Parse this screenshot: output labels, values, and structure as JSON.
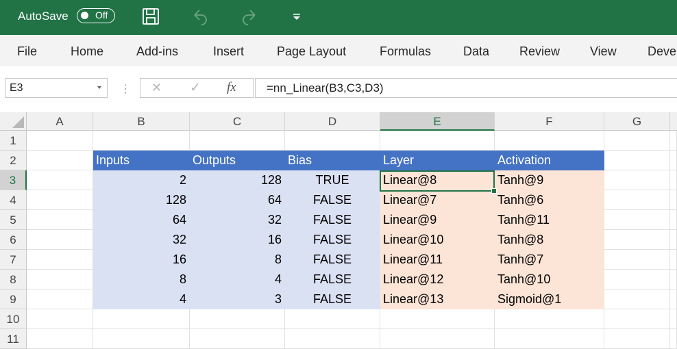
{
  "titlebar": {
    "autosave_label": "AutoSave",
    "autosave_state": "Off",
    "icons": [
      "save-icon",
      "undo-icon",
      "redo-icon",
      "customize-toolbar-icon"
    ],
    "color": "#217346"
  },
  "menu": {
    "file": "File",
    "home": "Home",
    "addins": "Add-ins",
    "insert": "Insert",
    "page_layout": "Page Layout",
    "formulas": "Formulas",
    "data": "Data",
    "review": "Review",
    "view": "View",
    "developer": "Deve"
  },
  "formula_bar": {
    "name_box": "E3",
    "separator": "⋮",
    "cancel_symbol": "✕",
    "enter_symbol": "✓",
    "fx_symbol": "fx",
    "formula": "=nn_Linear(B3,C3,D3)"
  },
  "columns": [
    "A",
    "B",
    "C",
    "D",
    "E",
    "F",
    "G"
  ],
  "rows": [
    "1",
    "2",
    "3",
    "4",
    "5",
    "6",
    "7",
    "8",
    "9",
    "10",
    "11"
  ],
  "table": {
    "headers": [
      "Inputs",
      "Outputs",
      "Bias",
      "Layer",
      "Activation"
    ],
    "rows": [
      [
        "2",
        "128",
        "TRUE",
        "Linear@8",
        "Tanh@9"
      ],
      [
        "128",
        "64",
        "FALSE",
        "Linear@7",
        "Tanh@6"
      ],
      [
        "64",
        "32",
        "FALSE",
        "Linear@9",
        "Tanh@11"
      ],
      [
        "32",
        "16",
        "FALSE",
        "Linear@10",
        "Tanh@8"
      ],
      [
        "16",
        "8",
        "FALSE",
        "Linear@11",
        "Tanh@7"
      ],
      [
        "8",
        "4",
        "FALSE",
        "Linear@12",
        "Tanh@10"
      ],
      [
        "4",
        "3",
        "FALSE",
        "Linear@13",
        "Sigmoid@1"
      ]
    ]
  },
  "selection": {
    "active_cell": "E3",
    "column": "E",
    "row": "3"
  },
  "colors": {
    "header_fill": "#4472c4",
    "input_fill": "#dae1f3",
    "output_fill": "#fce4d6",
    "accent": "#217346"
  }
}
